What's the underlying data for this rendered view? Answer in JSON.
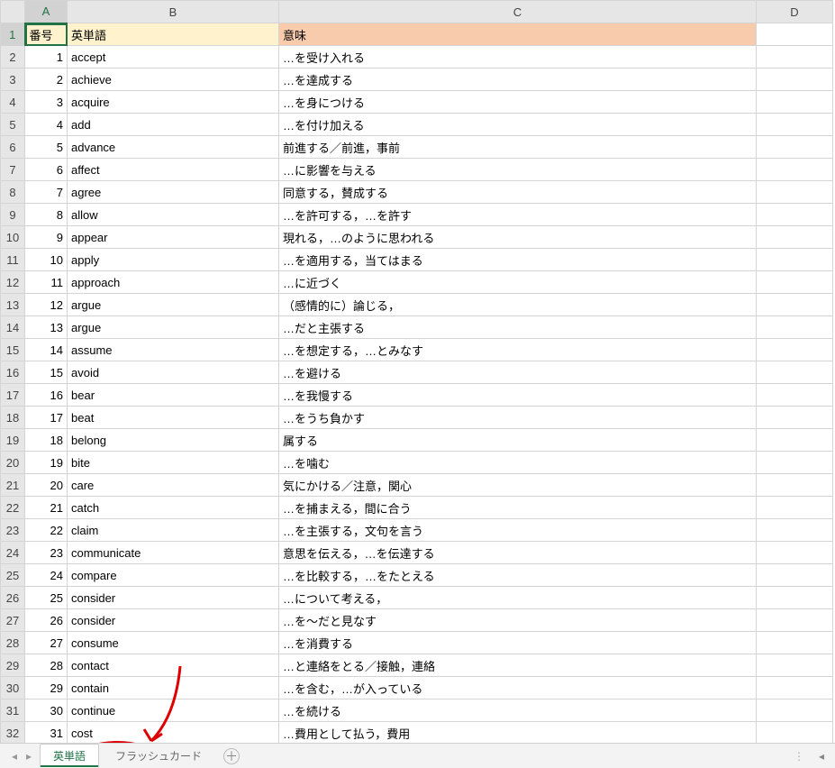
{
  "columns": [
    "A",
    "B",
    "C",
    "D"
  ],
  "header": {
    "a": "番号",
    "b": "英単語",
    "c": "意味"
  },
  "rows": [
    {
      "n": 1,
      "w": "accept",
      "m": "…を受け入れる"
    },
    {
      "n": 2,
      "w": "achieve",
      "m": "…を達成する"
    },
    {
      "n": 3,
      "w": "acquire",
      "m": "…を身につける"
    },
    {
      "n": 4,
      "w": "add",
      "m": "…を付け加える"
    },
    {
      "n": 5,
      "w": "advance",
      "m": "前進する／前進，事前"
    },
    {
      "n": 6,
      "w": "affect",
      "m": "…に影響を与える"
    },
    {
      "n": 7,
      "w": "agree",
      "m": "同意する，賛成する"
    },
    {
      "n": 8,
      "w": "allow",
      "m": "…を許可する，…を許す"
    },
    {
      "n": 9,
      "w": "appear",
      "m": "現れる，…のように思われる"
    },
    {
      "n": 10,
      "w": "apply",
      "m": "…を適用する，当てはまる"
    },
    {
      "n": 11,
      "w": "approach",
      "m": "…に近づく"
    },
    {
      "n": 12,
      "w": "argue",
      "m": "（感情的に）論じる，"
    },
    {
      "n": 13,
      "w": "argue",
      "m": "…だと主張する"
    },
    {
      "n": 14,
      "w": "assume",
      "m": "…を想定する，…とみなす"
    },
    {
      "n": 15,
      "w": "avoid",
      "m": "…を避ける"
    },
    {
      "n": 16,
      "w": "bear",
      "m": "…を我慢する"
    },
    {
      "n": 17,
      "w": "beat",
      "m": "…をうち負かす"
    },
    {
      "n": 18,
      "w": "belong",
      "m": "属する"
    },
    {
      "n": 19,
      "w": "bite",
      "m": "…を噛む"
    },
    {
      "n": 20,
      "w": "care",
      "m": "気にかける／注意，関心"
    },
    {
      "n": 21,
      "w": "catch",
      "m": "…を捕まえる，間に合う"
    },
    {
      "n": 22,
      "w": "claim",
      "m": "…を主張する，文句を言う"
    },
    {
      "n": 23,
      "w": "communicate",
      "m": "意思を伝える，…を伝達する"
    },
    {
      "n": 24,
      "w": "compare",
      "m": "…を比較する，…をたとえる"
    },
    {
      "n": 25,
      "w": "consider",
      "m": "…について考える，"
    },
    {
      "n": 26,
      "w": "consider",
      "m": "…を～だと見なす"
    },
    {
      "n": 27,
      "w": "consume",
      "m": "…を消費する"
    },
    {
      "n": 28,
      "w": "contact",
      "m": "…と連絡をとる／接触，連絡"
    },
    {
      "n": 29,
      "w": "contain",
      "m": "…を含む，…が入っている"
    },
    {
      "n": 30,
      "w": "continue",
      "m": "…を続ける"
    },
    {
      "n": 31,
      "w": "cost",
      "m": "…費用として払う，費用"
    }
  ],
  "tabs": {
    "active": "英単語",
    "second": "フラッシュカード"
  },
  "chart_data": {
    "type": "table",
    "title": "英単語",
    "columns": [
      "番号",
      "英単語",
      "意味"
    ],
    "data": [
      [
        1,
        "accept",
        "…を受け入れる"
      ],
      [
        2,
        "achieve",
        "…を達成する"
      ],
      [
        3,
        "acquire",
        "…を身につける"
      ],
      [
        4,
        "add",
        "…を付け加える"
      ],
      [
        5,
        "advance",
        "前進する／前進，事前"
      ],
      [
        6,
        "affect",
        "…に影響を与える"
      ],
      [
        7,
        "agree",
        "同意する，賛成する"
      ],
      [
        8,
        "allow",
        "…を許可する，…を許す"
      ],
      [
        9,
        "appear",
        "現れる，…のように思われる"
      ],
      [
        10,
        "apply",
        "…を適用する，当てはまる"
      ],
      [
        11,
        "approach",
        "…に近づく"
      ],
      [
        12,
        "argue",
        "（感情的に）論じる，"
      ],
      [
        13,
        "argue",
        "…だと主張する"
      ],
      [
        14,
        "assume",
        "…を想定する，…とみなす"
      ],
      [
        15,
        "avoid",
        "…を避ける"
      ],
      [
        16,
        "bear",
        "…を我慢する"
      ],
      [
        17,
        "beat",
        "…をうち負かす"
      ],
      [
        18,
        "belong",
        "属する"
      ],
      [
        19,
        "bite",
        "…を噛む"
      ],
      [
        20,
        "care",
        "気にかける／注意，関心"
      ],
      [
        21,
        "catch",
        "…を捕まえる，間に合う"
      ],
      [
        22,
        "claim",
        "…を主張する，文句を言う"
      ],
      [
        23,
        "communicate",
        "意思を伝える，…を伝達する"
      ],
      [
        24,
        "compare",
        "…を比較する，…をたとえる"
      ],
      [
        25,
        "consider",
        "…について考える，"
      ],
      [
        26,
        "consider",
        "…を～だと見なす"
      ],
      [
        27,
        "consume",
        "…を消費する"
      ],
      [
        28,
        "contact",
        "…と連絡をとる／接触，連絡"
      ],
      [
        29,
        "contain",
        "…を含む，…が入っている"
      ],
      [
        30,
        "continue",
        "…を続ける"
      ],
      [
        31,
        "cost",
        "…費用として払う，費用"
      ]
    ]
  }
}
